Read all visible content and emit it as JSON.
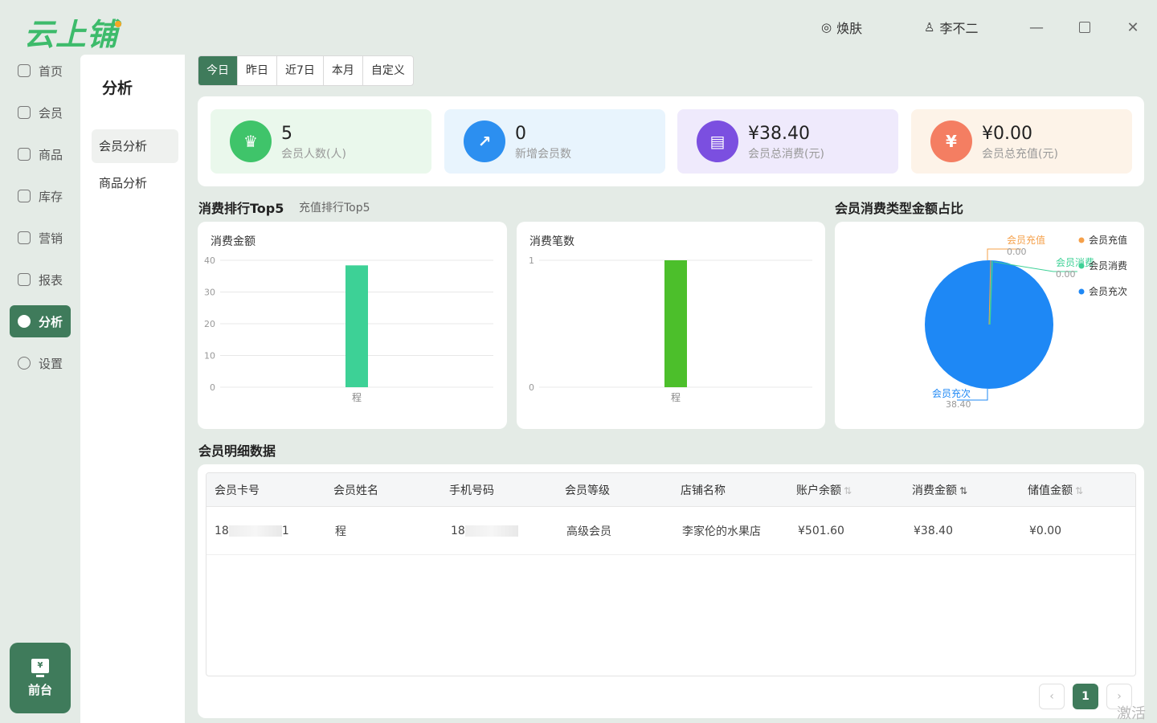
{
  "app": {
    "logo": "云上铺"
  },
  "topbar": {
    "skin_label": "焕肤",
    "user_label": "李不二"
  },
  "nav": {
    "items": [
      {
        "label": "首页"
      },
      {
        "label": "会员"
      },
      {
        "label": "商品"
      },
      {
        "label": "库存"
      },
      {
        "label": "营销"
      },
      {
        "label": "报表"
      },
      {
        "label": "分析"
      },
      {
        "label": "设置"
      }
    ],
    "active": "分析",
    "frontdesk_label": "前台"
  },
  "subnav": {
    "title": "分析",
    "items": [
      {
        "label": "会员分析"
      },
      {
        "label": "商品分析"
      }
    ]
  },
  "date_tabs": [
    "今日",
    "昨日",
    "近7日",
    "本月",
    "自定义"
  ],
  "stats": [
    {
      "value": "5",
      "label": "会员人数(人)",
      "color": "#3fc46a",
      "bg": "#eaf8ec"
    },
    {
      "value": "0",
      "label": "新增会员数",
      "color": "#2c8ff0",
      "bg": "#e8f4fd"
    },
    {
      "value": "¥38.40",
      "label": "会员总消费(元)",
      "color": "#7b4fe0",
      "bg": "#efeafc"
    },
    {
      "value": "¥0.00",
      "label": "会员总充值(元)",
      "color": "#f47e62",
      "bg": "#fdf3e8"
    }
  ],
  "ranking": {
    "title": "消费排行Top5",
    "alt_tab": "充值排行Top5"
  },
  "pie_section_title": "会员消费类型金额占比",
  "detail_title": "会员明细数据",
  "chart_data": [
    {
      "type": "bar",
      "title": "消费金额",
      "categories": [
        "程"
      ],
      "values": [
        38.4
      ],
      "ylim": [
        0,
        40
      ],
      "yticks": [
        0,
        10,
        20,
        30,
        40
      ],
      "color": "#3dd196",
      "grid": true
    },
    {
      "type": "bar",
      "title": "消费笔数",
      "categories": [
        "程"
      ],
      "values": [
        1
      ],
      "ylim": [
        0,
        1
      ],
      "yticks": [
        0,
        1
      ],
      "color": "#4cbf2b",
      "grid": true
    },
    {
      "type": "pie",
      "slices": [
        {
          "name": "会员充值",
          "value": 0.0,
          "label": "0.00",
          "color": "#f5a04a"
        },
        {
          "name": "会员消费",
          "value": 0.0,
          "label": "0.00",
          "color": "#3dd196"
        },
        {
          "name": "会员充次",
          "value": 38.4,
          "label": "38.40",
          "color": "#1e88f5"
        }
      ],
      "legend": "top-right"
    }
  ],
  "table": {
    "columns": [
      "会员卡号",
      "会员姓名",
      "手机号码",
      "会员等级",
      "店铺名称",
      "账户余额",
      "消费金额",
      "储值金额"
    ],
    "rows": [
      {
        "card_no": "18",
        "card_no_tail": "1",
        "name": "程",
        "phone": "18",
        "level": "高级会员",
        "store": "李家伦的水果店",
        "balance": "¥501.60",
        "spend": "¥38.40",
        "stored": "¥0.00"
      }
    ]
  },
  "pagination": {
    "current": "1"
  },
  "watermark": "激活"
}
